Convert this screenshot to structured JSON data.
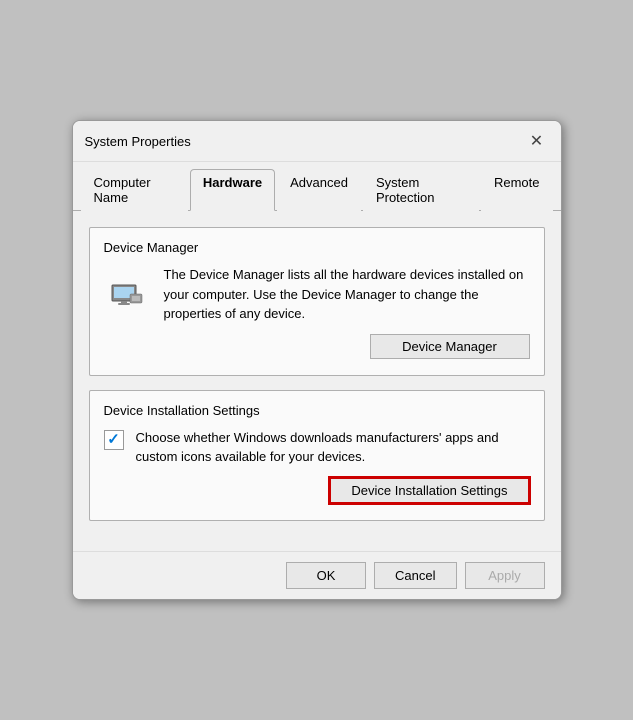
{
  "dialog": {
    "title": "System Properties",
    "close_label": "✕"
  },
  "tabs": [
    {
      "id": "computer-name",
      "label": "Computer Name",
      "active": false
    },
    {
      "id": "hardware",
      "label": "Hardware",
      "active": true
    },
    {
      "id": "advanced",
      "label": "Advanced",
      "active": false
    },
    {
      "id": "system-protection",
      "label": "System Protection",
      "active": false
    },
    {
      "id": "remote",
      "label": "Remote",
      "active": false
    }
  ],
  "sections": {
    "device_manager": {
      "title": "Device Manager",
      "description": "The Device Manager lists all the hardware devices installed on your computer. Use the Device Manager to change the properties of any device.",
      "button_label": "Device Manager"
    },
    "device_installation": {
      "title": "Device Installation Settings",
      "description": "Choose whether Windows downloads manufacturers' apps and custom icons available for your devices.",
      "button_label": "Device Installation Settings"
    }
  },
  "footer": {
    "ok_label": "OK",
    "cancel_label": "Cancel",
    "apply_label": "Apply"
  }
}
